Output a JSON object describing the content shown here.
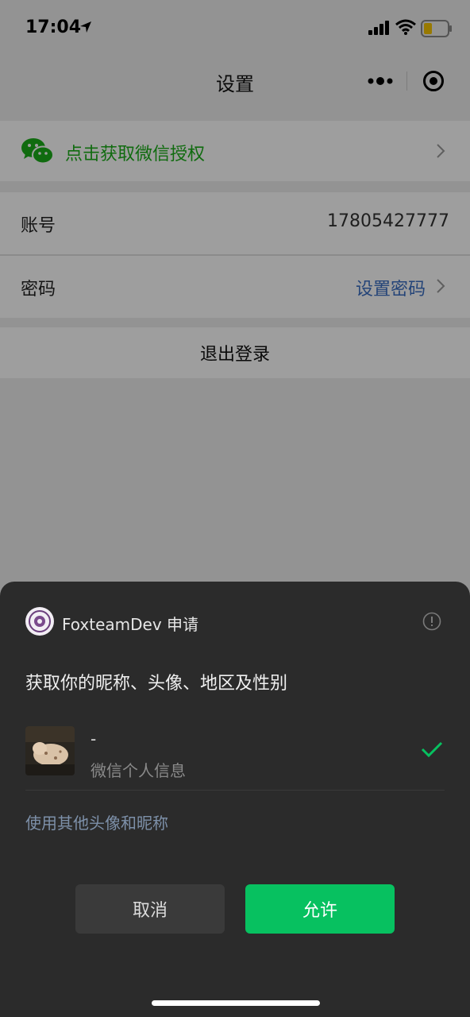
{
  "status_bar": {
    "time": "17:04"
  },
  "nav": {
    "title": "设置"
  },
  "settings": {
    "auth_label": "点击获取微信授权",
    "account_label": "账号",
    "account_value": "17805427777",
    "password_label": "密码",
    "password_link": "设置密码",
    "logout_label": "退出登录"
  },
  "sheet": {
    "app_name": "FoxteamDev 申请",
    "request_title": "获取你的昵称、头像、地区及性别",
    "profile_name": "-",
    "profile_sub": "微信个人信息",
    "other_link": "使用其他头像和昵称",
    "cancel_label": "取消",
    "allow_label": "允许"
  },
  "colors": {
    "wechat_green": "#07c160",
    "link_blue": "#3a6ec2",
    "sheet_bg": "#2b2b2b"
  }
}
